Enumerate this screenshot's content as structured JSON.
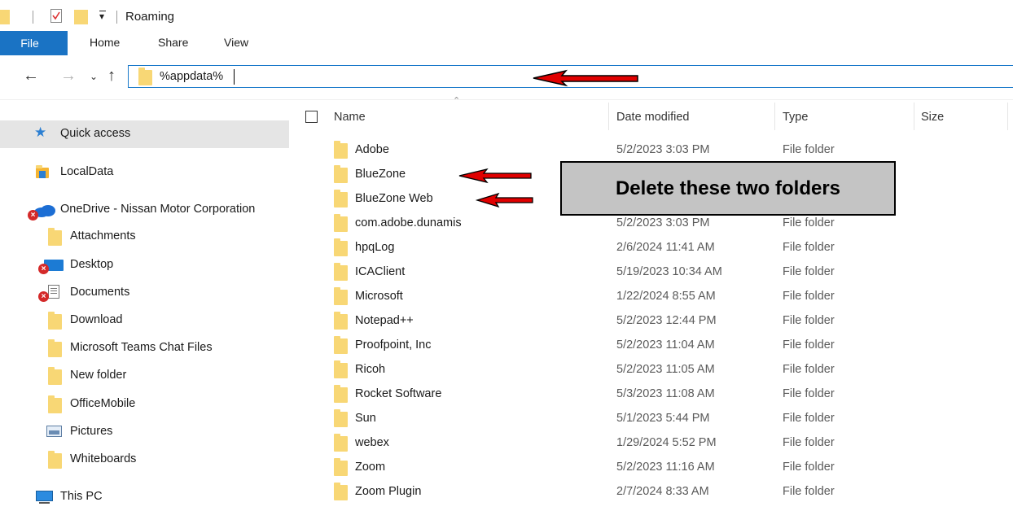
{
  "window": {
    "title": "Roaming"
  },
  "ribbon": {
    "tabs": [
      "File",
      "Home",
      "Share",
      "View"
    ]
  },
  "address": {
    "path": "%appdata%"
  },
  "nav_pane": {
    "items": [
      {
        "label": "Quick access",
        "icon": "star-icon"
      },
      {
        "label": "LocalData",
        "icon": "folder-icon"
      },
      {
        "label": "OneDrive - Nissan Motor Corporation",
        "icon": "onedrive-icon"
      },
      {
        "label": "Attachments",
        "icon": "folder-icon"
      },
      {
        "label": "Desktop",
        "icon": "desktop-icon"
      },
      {
        "label": "Documents",
        "icon": "documents-icon"
      },
      {
        "label": "Download",
        "icon": "folder-icon"
      },
      {
        "label": "Microsoft Teams Chat Files",
        "icon": "folder-icon"
      },
      {
        "label": "New folder",
        "icon": "folder-icon"
      },
      {
        "label": "OfficeMobile",
        "icon": "folder-icon"
      },
      {
        "label": "Pictures",
        "icon": "pictures-icon"
      },
      {
        "label": "Whiteboards",
        "icon": "folder-icon"
      },
      {
        "label": "This PC",
        "icon": "this-pc-icon"
      }
    ]
  },
  "file_list": {
    "columns": {
      "name": "Name",
      "date": "Date modified",
      "type": "Type",
      "size": "Size"
    },
    "rows": [
      {
        "name": "Adobe",
        "date": "5/2/2023 3:03 PM",
        "type": "File folder"
      },
      {
        "name": "BlueZone",
        "date": "",
        "type": ""
      },
      {
        "name": "BlueZone Web",
        "date": "",
        "type": ""
      },
      {
        "name": "com.adobe.dunamis",
        "date": "5/2/2023 3:03 PM",
        "type": "File folder"
      },
      {
        "name": "hpqLog",
        "date": "2/6/2024 11:41 AM",
        "type": "File folder"
      },
      {
        "name": "ICAClient",
        "date": "5/19/2023 10:34 AM",
        "type": "File folder"
      },
      {
        "name": "Microsoft",
        "date": "1/22/2024 8:55 AM",
        "type": "File folder"
      },
      {
        "name": "Notepad++",
        "date": "5/2/2023 12:44 PM",
        "type": "File folder"
      },
      {
        "name": "Proofpoint, Inc",
        "date": "5/2/2023 11:04 AM",
        "type": "File folder"
      },
      {
        "name": "Ricoh",
        "date": "5/2/2023 11:05 AM",
        "type": "File folder"
      },
      {
        "name": "Rocket Software",
        "date": "5/3/2023 11:08 AM",
        "type": "File folder"
      },
      {
        "name": "Sun",
        "date": "5/1/2023 5:44 PM",
        "type": "File folder"
      },
      {
        "name": "webex",
        "date": "1/29/2024 5:52 PM",
        "type": "File folder"
      },
      {
        "name": "Zoom",
        "date": "5/2/2023 11:16 AM",
        "type": "File folder"
      },
      {
        "name": "Zoom Plugin",
        "date": "2/7/2024 8:33 AM",
        "type": "File folder"
      }
    ]
  },
  "annotation": {
    "callout": "Delete these two folders"
  },
  "colors": {
    "accent": "#1a73c4",
    "arrow": "#e00000",
    "folder": "#f8d775",
    "callout_bg": "#c4c4c4"
  }
}
